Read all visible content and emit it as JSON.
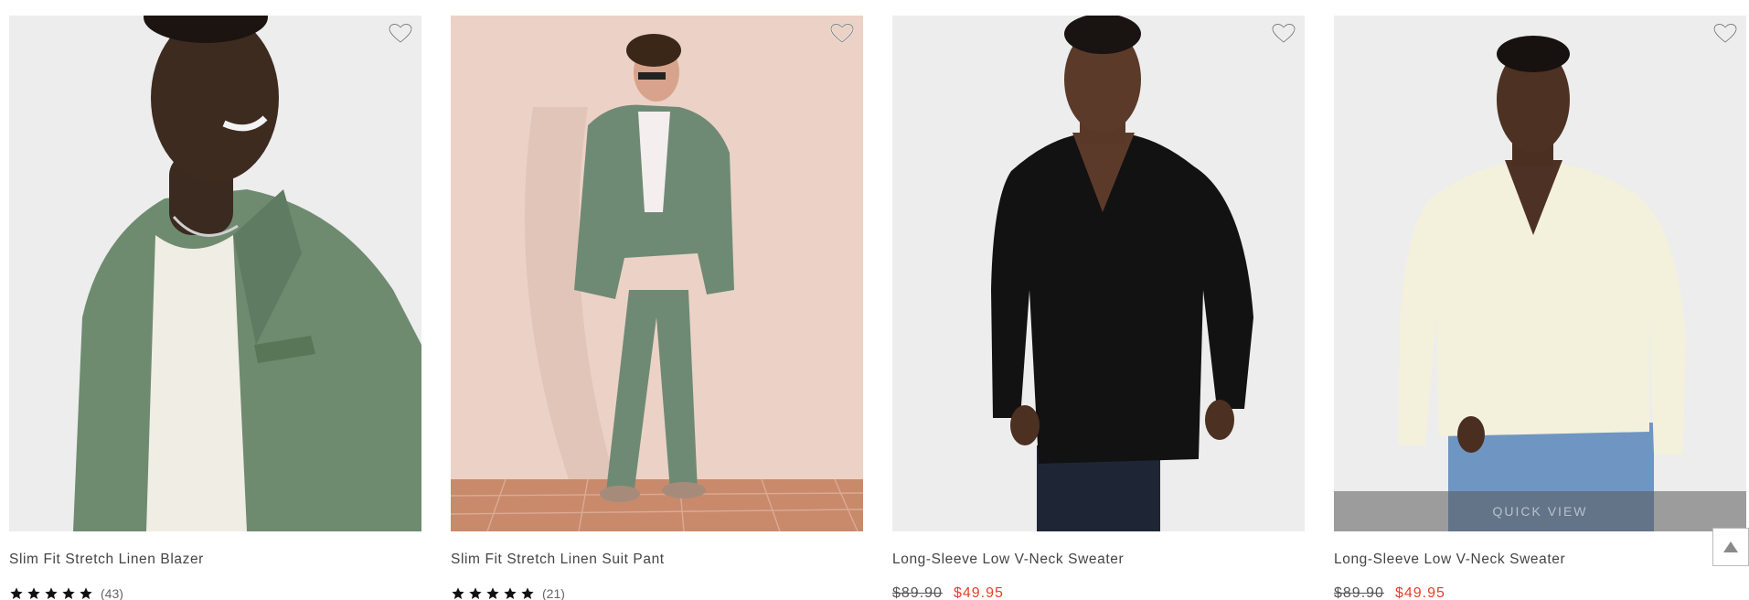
{
  "products": [
    {
      "name": "Slim Fit Stretch Linen Blazer",
      "rating_count": "(43)",
      "rating": 5,
      "bg": "#ededed",
      "accent": "#6e8b70"
    },
    {
      "name": "Slim Fit Stretch Linen Suit Pant",
      "rating_count": "(21)",
      "rating": 5,
      "bg": "#ecd2c6",
      "accent": "#6f8a74"
    },
    {
      "name": "Long-Sleeve Low V-Neck Sweater",
      "old_price": "$89.90",
      "sale_price": "$49.95",
      "bg": "#ededed",
      "accent": "#111111"
    },
    {
      "name": "Long-Sleeve Low V-Neck Sweater",
      "old_price": "$89.90",
      "sale_price": "$49.95",
      "quick_view": "QUICK VIEW",
      "bg": "#ededed",
      "accent": "#f3f0dc"
    }
  ],
  "colors": {
    "sale": "#e4402a",
    "star": "#111111"
  },
  "icons": {
    "favorite": "heart-outline-icon",
    "scroll": "arrow-up-icon",
    "rating": "star-icon"
  }
}
